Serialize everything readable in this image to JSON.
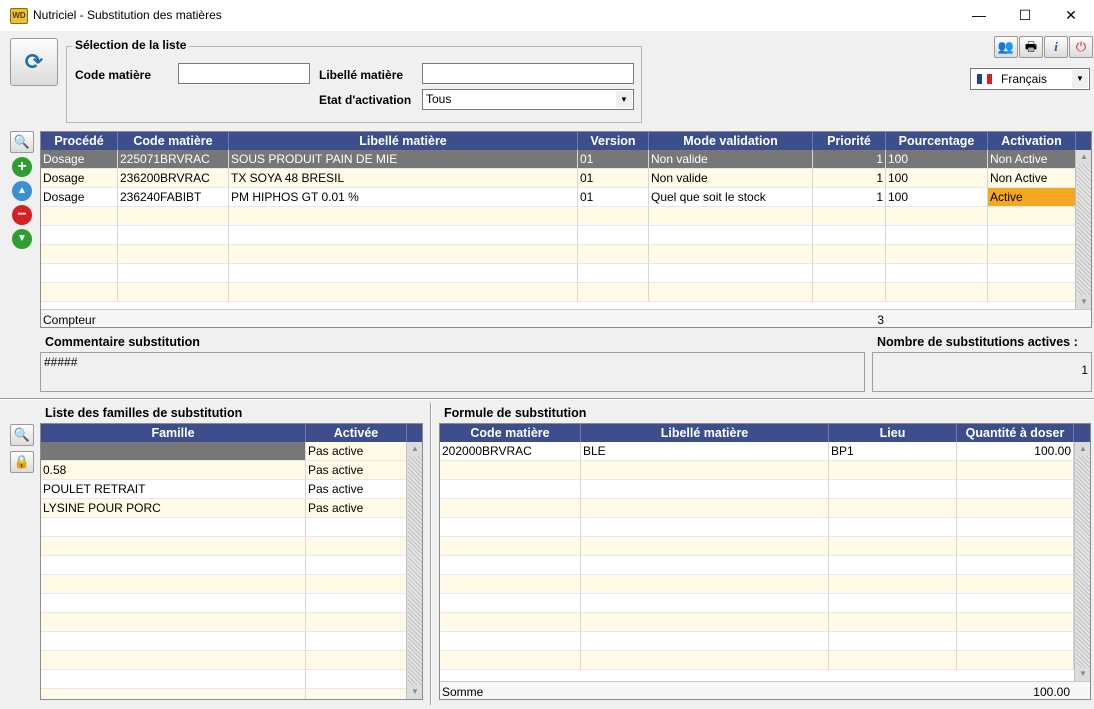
{
  "window": {
    "title": "Nutriciel - Substitution des matières",
    "app_icon": "WD",
    "controls": {
      "minimize": "—",
      "maximize": "☐",
      "close": "✕"
    }
  },
  "selection": {
    "legend": "Sélection de la liste",
    "code_label": "Code matière",
    "code_value": "",
    "libelle_label": "Libellé matière",
    "libelle_value": "",
    "etat_label": "Etat d'activation",
    "etat_value": "Tous"
  },
  "language": {
    "value": "Français"
  },
  "substitutions": {
    "headers": [
      "Procédé",
      "Code matière",
      "Libellé matière",
      "Version",
      "Mode validation",
      "Priorité",
      "Pourcentage",
      "Activation"
    ],
    "rows": [
      {
        "procede": "Dosage",
        "code": "225071BRVRAC",
        "libelle": "SOUS PRODUIT PAIN DE MIE",
        "version": "01",
        "mode": "Non valide",
        "priorite": "1",
        "pourcentage": "100",
        "activation": "Non Active"
      },
      {
        "procede": "Dosage",
        "code": "236200BRVRAC",
        "libelle": "TX SOYA 48 BRESIL",
        "version": "01",
        "mode": "Non valide",
        "priorite": "1",
        "pourcentage": "100",
        "activation": "Non Active"
      },
      {
        "procede": "Dosage",
        "code": "236240FABIBT",
        "libelle": "PM HIPHOS GT 0.01 %",
        "version": "01",
        "mode": "Quel que soit le stock",
        "priorite": "1",
        "pourcentage": "100",
        "activation": "Active"
      }
    ],
    "footer_label": "Compteur",
    "footer_count": "3"
  },
  "comment": {
    "label": "Commentaire substitution",
    "value": "#####"
  },
  "active_count": {
    "label": "Nombre de substitutions actives :",
    "value": "1"
  },
  "families": {
    "title": "Liste des familles de substitution",
    "headers": [
      "Famille",
      "Activée"
    ],
    "rows": [
      {
        "famille": "",
        "activee": "Pas active"
      },
      {
        "famille": "0.58",
        "activee": "Pas active"
      },
      {
        "famille": "POULET RETRAIT",
        "activee": "Pas active"
      },
      {
        "famille": "LYSINE POUR PORC",
        "activee": "Pas active"
      }
    ]
  },
  "formula": {
    "title": "Formule de substitution",
    "headers": [
      "Code matière",
      "Libellé matière",
      "Lieu",
      "Quantité à doser"
    ],
    "rows": [
      {
        "code": "202000BRVRAC",
        "libelle": "BLE",
        "lieu": "BP1",
        "quantite": "100.00"
      }
    ],
    "footer_label": "Somme",
    "footer_total": "100.00"
  },
  "colors": {
    "header_bg": "#3c4e8c",
    "row_alt": "#fffbe6",
    "selected_row": "#777777",
    "active_badge": "#f5a623"
  }
}
